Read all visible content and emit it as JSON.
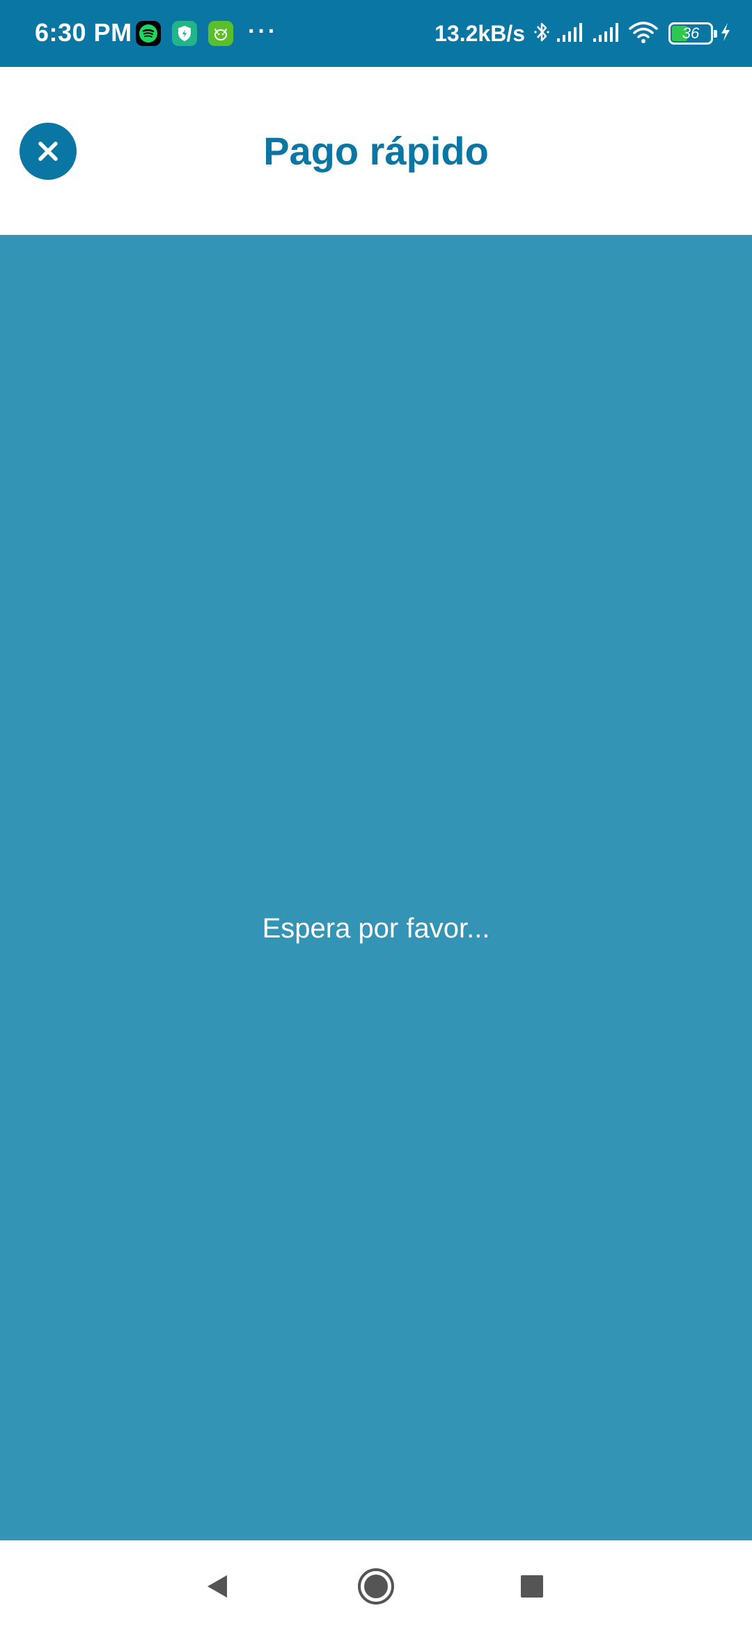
{
  "status_bar": {
    "time": "6:30 PM",
    "notification_icons": [
      "spotify-icon",
      "shield-app-icon",
      "cat-app-icon"
    ],
    "overflow": "···",
    "net_speed": "13.2kB/s",
    "battery_level": "36",
    "system_icons": [
      "bluetooth-icon",
      "signal-icon",
      "signal-icon",
      "wifi-icon",
      "battery-icon",
      "charging-icon"
    ]
  },
  "header": {
    "title": "Pago rápido",
    "close_icon": "close-icon"
  },
  "main": {
    "loading_text": "Espera por favor..."
  },
  "nav_bar": {
    "buttons": [
      "back-icon",
      "home-icon",
      "recents-icon"
    ]
  },
  "colors": {
    "primary": "#0a76a4",
    "loading_background": "#3394b5",
    "surface": "#ffffff"
  }
}
